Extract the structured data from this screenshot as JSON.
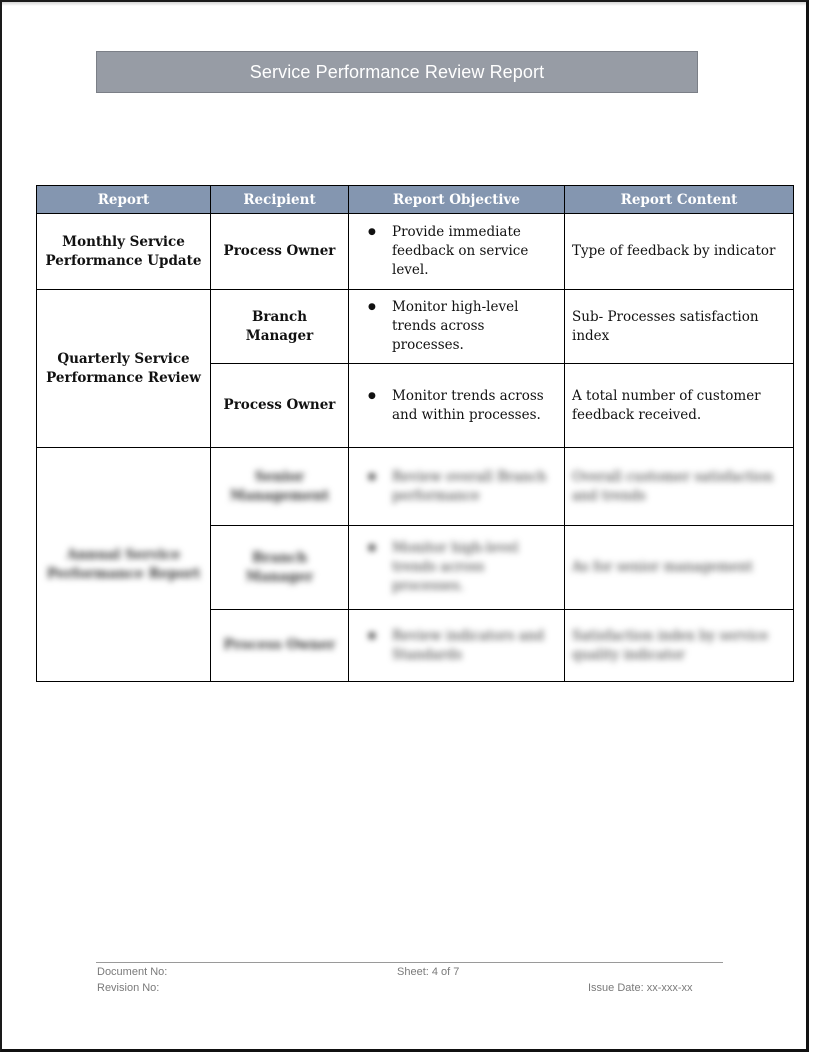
{
  "document": {
    "title": "Service Performance Review Report",
    "table": {
      "headers": [
        "Report",
        "Recipient",
        "Report Objective",
        "Report Content"
      ],
      "groups": [
        {
          "report": "Monthly Service Performance Update",
          "rows": [
            {
              "recipient": "Process Owner",
              "objective": "Provide immediate feedback on service level.",
              "content": "Type of feedback by indicator"
            }
          ]
        },
        {
          "report": "Quarterly Service Performance Review",
          "rows": [
            {
              "recipient": "Branch Manager",
              "objective": "Monitor high-level trends across processes.",
              "content": "Sub- Processes satisfaction index"
            },
            {
              "recipient": "Process Owner",
              "objective": "Monitor trends across and within processes.",
              "content": "A total number of customer feedback received."
            }
          ]
        },
        {
          "report": "Annual Service Performance Report",
          "blurred": true,
          "rows": [
            {
              "recipient": "Senior Management",
              "objective": "Review overall Branch performance",
              "content": "Overall customer satisfaction and trends"
            },
            {
              "recipient": "Branch Manager",
              "objective": "Monitor high-level trends across processes.",
              "content": "As for senior management"
            },
            {
              "recipient": "Process Owner",
              "objective": "Review indicators and Standards",
              "content": "Satisfaction index by service quality indicator"
            }
          ]
        }
      ]
    },
    "footer": {
      "document_no": "Document No:",
      "revision_no": "Revision No:",
      "sheet": "Sheet: 4 of 7",
      "issue_date": "Issue Date: xx-xxx-xx"
    }
  }
}
